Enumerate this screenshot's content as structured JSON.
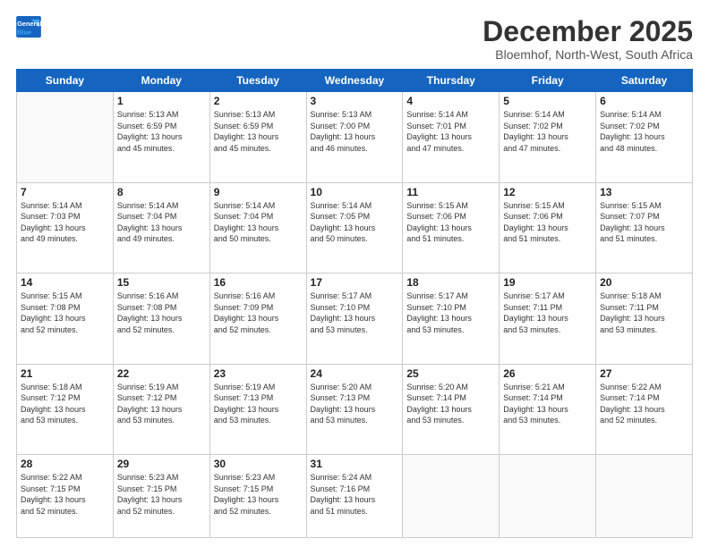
{
  "logo": {
    "line1": "General",
    "line2": "Blue"
  },
  "title": "December 2025",
  "subtitle": "Bloemhof, North-West, South Africa",
  "header_days": [
    "Sunday",
    "Monday",
    "Tuesday",
    "Wednesday",
    "Thursday",
    "Friday",
    "Saturday"
  ],
  "weeks": [
    [
      {
        "day": "",
        "info": ""
      },
      {
        "day": "1",
        "info": "Sunrise: 5:13 AM\nSunset: 6:59 PM\nDaylight: 13 hours\nand 45 minutes."
      },
      {
        "day": "2",
        "info": "Sunrise: 5:13 AM\nSunset: 6:59 PM\nDaylight: 13 hours\nand 45 minutes."
      },
      {
        "day": "3",
        "info": "Sunrise: 5:13 AM\nSunset: 7:00 PM\nDaylight: 13 hours\nand 46 minutes."
      },
      {
        "day": "4",
        "info": "Sunrise: 5:14 AM\nSunset: 7:01 PM\nDaylight: 13 hours\nand 47 minutes."
      },
      {
        "day": "5",
        "info": "Sunrise: 5:14 AM\nSunset: 7:02 PM\nDaylight: 13 hours\nand 47 minutes."
      },
      {
        "day": "6",
        "info": "Sunrise: 5:14 AM\nSunset: 7:02 PM\nDaylight: 13 hours\nand 48 minutes."
      }
    ],
    [
      {
        "day": "7",
        "info": "Sunrise: 5:14 AM\nSunset: 7:03 PM\nDaylight: 13 hours\nand 49 minutes."
      },
      {
        "day": "8",
        "info": "Sunrise: 5:14 AM\nSunset: 7:04 PM\nDaylight: 13 hours\nand 49 minutes."
      },
      {
        "day": "9",
        "info": "Sunrise: 5:14 AM\nSunset: 7:04 PM\nDaylight: 13 hours\nand 50 minutes."
      },
      {
        "day": "10",
        "info": "Sunrise: 5:14 AM\nSunset: 7:05 PM\nDaylight: 13 hours\nand 50 minutes."
      },
      {
        "day": "11",
        "info": "Sunrise: 5:15 AM\nSunset: 7:06 PM\nDaylight: 13 hours\nand 51 minutes."
      },
      {
        "day": "12",
        "info": "Sunrise: 5:15 AM\nSunset: 7:06 PM\nDaylight: 13 hours\nand 51 minutes."
      },
      {
        "day": "13",
        "info": "Sunrise: 5:15 AM\nSunset: 7:07 PM\nDaylight: 13 hours\nand 51 minutes."
      }
    ],
    [
      {
        "day": "14",
        "info": "Sunrise: 5:15 AM\nSunset: 7:08 PM\nDaylight: 13 hours\nand 52 minutes."
      },
      {
        "day": "15",
        "info": "Sunrise: 5:16 AM\nSunset: 7:08 PM\nDaylight: 13 hours\nand 52 minutes."
      },
      {
        "day": "16",
        "info": "Sunrise: 5:16 AM\nSunset: 7:09 PM\nDaylight: 13 hours\nand 52 minutes."
      },
      {
        "day": "17",
        "info": "Sunrise: 5:17 AM\nSunset: 7:10 PM\nDaylight: 13 hours\nand 53 minutes."
      },
      {
        "day": "18",
        "info": "Sunrise: 5:17 AM\nSunset: 7:10 PM\nDaylight: 13 hours\nand 53 minutes."
      },
      {
        "day": "19",
        "info": "Sunrise: 5:17 AM\nSunset: 7:11 PM\nDaylight: 13 hours\nand 53 minutes."
      },
      {
        "day": "20",
        "info": "Sunrise: 5:18 AM\nSunset: 7:11 PM\nDaylight: 13 hours\nand 53 minutes."
      }
    ],
    [
      {
        "day": "21",
        "info": "Sunrise: 5:18 AM\nSunset: 7:12 PM\nDaylight: 13 hours\nand 53 minutes."
      },
      {
        "day": "22",
        "info": "Sunrise: 5:19 AM\nSunset: 7:12 PM\nDaylight: 13 hours\nand 53 minutes."
      },
      {
        "day": "23",
        "info": "Sunrise: 5:19 AM\nSunset: 7:13 PM\nDaylight: 13 hours\nand 53 minutes."
      },
      {
        "day": "24",
        "info": "Sunrise: 5:20 AM\nSunset: 7:13 PM\nDaylight: 13 hours\nand 53 minutes."
      },
      {
        "day": "25",
        "info": "Sunrise: 5:20 AM\nSunset: 7:14 PM\nDaylight: 13 hours\nand 53 minutes."
      },
      {
        "day": "26",
        "info": "Sunrise: 5:21 AM\nSunset: 7:14 PM\nDaylight: 13 hours\nand 53 minutes."
      },
      {
        "day": "27",
        "info": "Sunrise: 5:22 AM\nSunset: 7:14 PM\nDaylight: 13 hours\nand 52 minutes."
      }
    ],
    [
      {
        "day": "28",
        "info": "Sunrise: 5:22 AM\nSunset: 7:15 PM\nDaylight: 13 hours\nand 52 minutes."
      },
      {
        "day": "29",
        "info": "Sunrise: 5:23 AM\nSunset: 7:15 PM\nDaylight: 13 hours\nand 52 minutes."
      },
      {
        "day": "30",
        "info": "Sunrise: 5:23 AM\nSunset: 7:15 PM\nDaylight: 13 hours\nand 52 minutes."
      },
      {
        "day": "31",
        "info": "Sunrise: 5:24 AM\nSunset: 7:16 PM\nDaylight: 13 hours\nand 51 minutes."
      },
      {
        "day": "",
        "info": ""
      },
      {
        "day": "",
        "info": ""
      },
      {
        "day": "",
        "info": ""
      }
    ]
  ]
}
